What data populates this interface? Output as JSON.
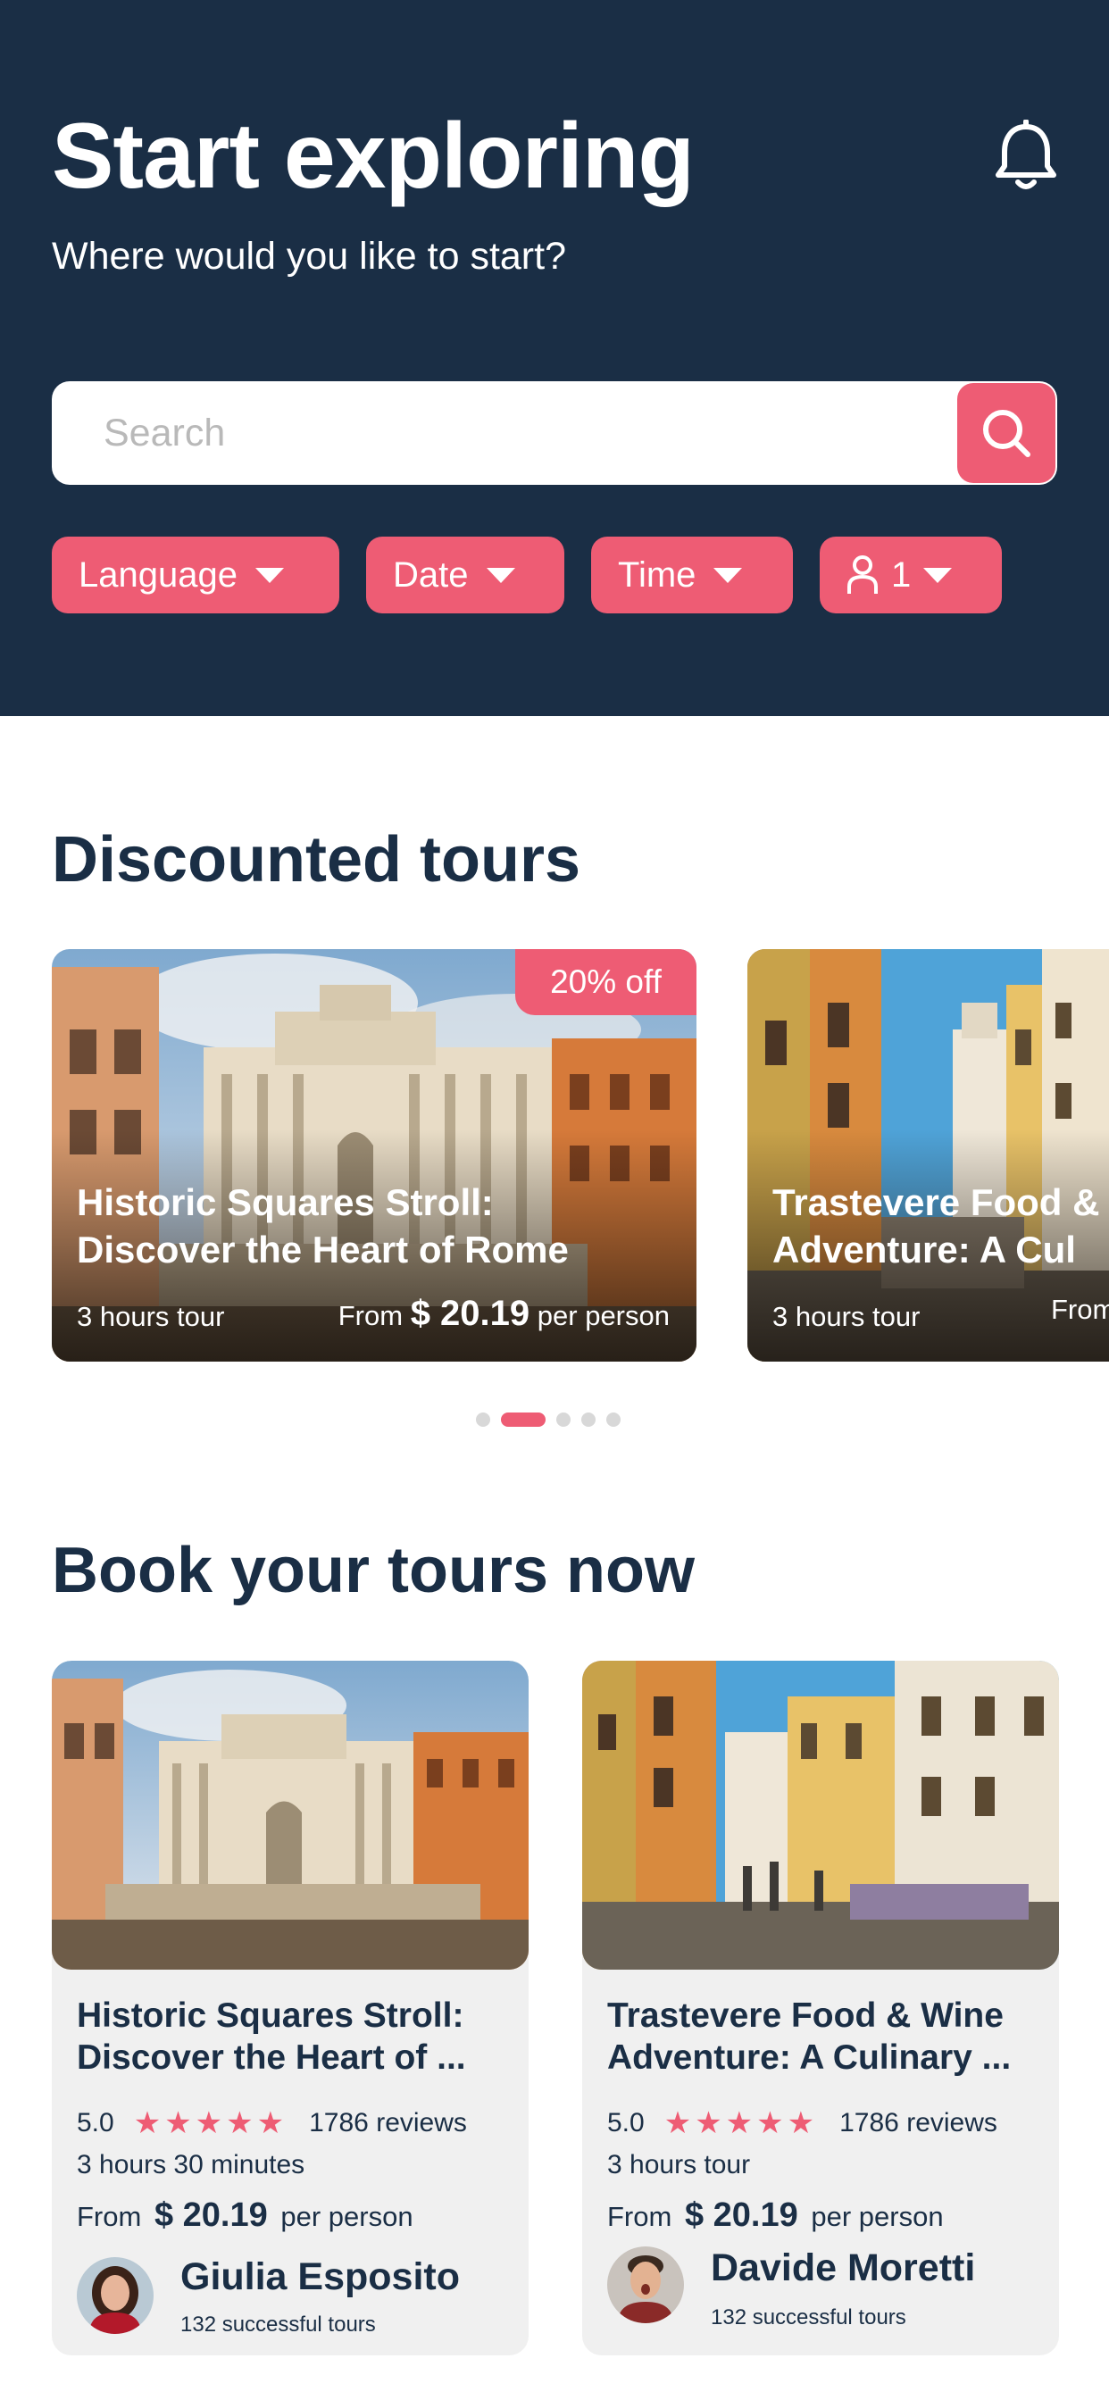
{
  "header": {
    "title": "Start exploring",
    "subtitle": "Where would you like to start?",
    "search_placeholder": "Search"
  },
  "filters": {
    "language": "Language",
    "date": "Date",
    "time": "Time",
    "people": "1"
  },
  "discounted": {
    "section_title": "Discounted tours",
    "cards": [
      {
        "badge": "20% off",
        "title_line1": "Historic Squares Stroll:",
        "title_line2": "Discover the Heart of Rome",
        "duration": "3 hours tour",
        "price_from": "From",
        "price": "$ 20.19",
        "price_unit": "per person"
      },
      {
        "title_line1": "Trastevere Food &",
        "title_line2": "Adventure: A Cul",
        "duration": "3 hours tour",
        "price_from": "From"
      }
    ],
    "pager": {
      "count": 5,
      "active_index": 1
    }
  },
  "book": {
    "section_title": "Book your tours now",
    "cards": [
      {
        "title_line1": "Historic Squares Stroll:",
        "title_line2": "Discover the Heart of ...",
        "rating": "5.0",
        "stars": "★★★★★",
        "reviews": "1786 reviews",
        "duration": "3 hours 30 minutes",
        "price_from": "From",
        "price": "$ 20.19",
        "price_unit": "per person",
        "guide_name": "Giulia Esposito",
        "guide_tours": "132 successful tours"
      },
      {
        "title_line1": "Trastevere Food & Wine",
        "title_line2": "Adventure: A Culinary ...",
        "rating": "5.0",
        "stars": "★★★★★",
        "reviews": "1786 reviews",
        "duration": "3 hours tour",
        "price_from": "From",
        "price": "$ 20.19",
        "price_unit": "per person",
        "guide_name": "Davide Moretti",
        "guide_tours": "132 successful tours"
      }
    ]
  },
  "colors": {
    "navy": "#1a2e45",
    "accent": "#ee5c74",
    "card_bg": "#f0f0f0"
  },
  "icons": [
    "bell-icon",
    "search-icon",
    "caret-down-icon",
    "person-icon",
    "star-icon"
  ]
}
